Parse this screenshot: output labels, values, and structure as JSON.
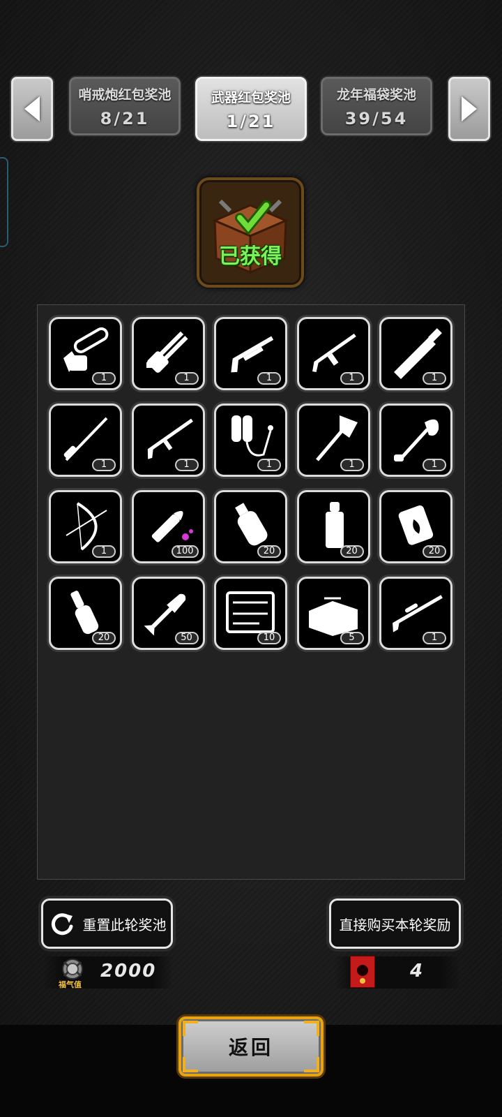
{
  "pools": [
    {
      "name": "哨戒炮红包奖池",
      "count": "8/21",
      "active": false
    },
    {
      "name": "武器红包奖池",
      "count": "1/21",
      "active": true
    },
    {
      "name": "龙年福袋奖池",
      "count": "39/54",
      "active": false
    }
  ],
  "chest": {
    "status": "已获得"
  },
  "items": [
    {
      "icon": "chainsaw-icon",
      "qty": "1"
    },
    {
      "icon": "gatling-gun-icon",
      "qty": "1"
    },
    {
      "icon": "shotgun-icon",
      "qty": "1"
    },
    {
      "icon": "assault-rifle-icon",
      "qty": "1"
    },
    {
      "icon": "broadsword-icon",
      "qty": "1"
    },
    {
      "icon": "spear-icon",
      "qty": "1"
    },
    {
      "icon": "rifle-icon",
      "qty": "1"
    },
    {
      "icon": "flamethrower-icon",
      "qty": "1"
    },
    {
      "icon": "axe-icon",
      "qty": "1"
    },
    {
      "icon": "shovel-icon",
      "qty": "1"
    },
    {
      "icon": "compound-bow-icon",
      "qty": "1"
    },
    {
      "icon": "bullet-icon",
      "qty": "100"
    },
    {
      "icon": "frag-grenade-icon",
      "qty": "20"
    },
    {
      "icon": "incendiary-grenade-icon",
      "qty": "20"
    },
    {
      "icon": "fire-mine-icon",
      "qty": "20"
    },
    {
      "icon": "stick-grenade-icon",
      "qty": "20"
    },
    {
      "icon": "rocket-icon",
      "qty": "50"
    },
    {
      "icon": "tool-case-icon",
      "qty": "10"
    },
    {
      "icon": "toolbox-icon",
      "qty": "5"
    },
    {
      "icon": "sniper-rifle-icon",
      "qty": "1"
    }
  ],
  "buttons": {
    "reset": "重置此轮奖池",
    "buy": "直接购买本轮奖励",
    "back": "返回"
  },
  "stats": {
    "luck_label": "福气值",
    "luck_value": "2000",
    "redpack_value": "4"
  }
}
